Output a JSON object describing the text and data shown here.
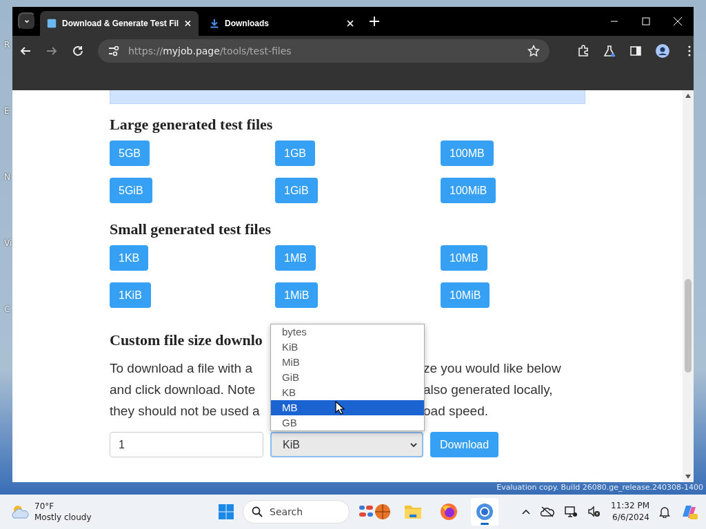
{
  "desktop": {
    "icon_labels": [
      "R",
      "E",
      "N",
      "Vi",
      "C"
    ],
    "watermark": "Evaluation copy. Build 26080.ge_release.240308-1400"
  },
  "browser": {
    "tabs": [
      {
        "title": "Download & Generate Test Fil",
        "kind": "page",
        "selected": true
      },
      {
        "title": "Downloads",
        "kind": "download",
        "selected": false
      }
    ],
    "url": {
      "scheme": "https://",
      "host": "myjob.page",
      "path": "/tools/test-files"
    }
  },
  "page": {
    "sections": [
      {
        "heading": "Large generated test files",
        "buttons": [
          "5GB",
          "1GB",
          "100MB",
          "5GiB",
          "1GiB",
          "100MiB"
        ]
      },
      {
        "heading": "Small generated test files",
        "buttons": [
          "1KB",
          "1MB",
          "10MB",
          "1KiB",
          "1MiB",
          "10MiB"
        ]
      }
    ],
    "custom": {
      "heading": "Custom file size downlo",
      "lines": [
        {
          "left": "To download a file with a",
          "right": "ze you would like below"
        },
        {
          "left": "and click download. Note",
          "right": "also generated locally,"
        },
        {
          "left": "they should not be used a",
          "right": "oad speed."
        }
      ],
      "size_value": "1",
      "unit_value": "KiB",
      "button": "Download",
      "options": [
        {
          "label": "bytes",
          "selected": false
        },
        {
          "label": "KiB",
          "selected": false
        },
        {
          "label": "MiB",
          "selected": false
        },
        {
          "label": "GiB",
          "selected": false
        },
        {
          "label": "KB",
          "selected": false
        },
        {
          "label": "MB",
          "selected": true
        },
        {
          "label": "GB",
          "selected": false
        }
      ]
    }
  },
  "taskbar": {
    "weather": {
      "temperature": "70°F",
      "condition": "Mostly cloudy"
    },
    "search_placeholder": "Search",
    "apps": [
      {
        "kind": "folder",
        "active": false
      },
      {
        "kind": "firefox",
        "active": false
      },
      {
        "kind": "chrome",
        "active": true
      }
    ],
    "time": "11:32 PM",
    "date": "6/6/2024"
  }
}
